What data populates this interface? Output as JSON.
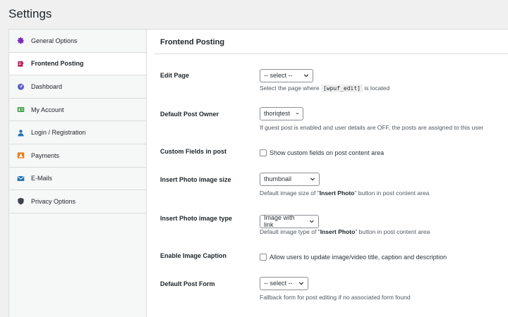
{
  "page_title": "Settings",
  "sidebar": {
    "items": [
      {
        "label": "General Options",
        "icon": "gear-icon",
        "color": "#7b2cbf",
        "active": false
      },
      {
        "label": "Frontend Posting",
        "icon": "edit-icon",
        "color": "#c2185b",
        "active": true
      },
      {
        "label": "Dashboard",
        "icon": "dashboard-icon",
        "color": "#5b5fc7",
        "active": false
      },
      {
        "label": "My Account",
        "icon": "account-card-icon",
        "color": "#43a047",
        "active": false
      },
      {
        "label": "Login / Registration",
        "icon": "user-icon",
        "color": "#2271b1",
        "active": false
      },
      {
        "label": "Payments",
        "icon": "payments-icon",
        "color": "#e67e22",
        "active": false
      },
      {
        "label": "E-Mails",
        "icon": "mail-icon",
        "color": "#2271b1",
        "active": false
      },
      {
        "label": "Privacy Options",
        "icon": "shield-icon",
        "color": "#3c434a",
        "active": false
      }
    ]
  },
  "main": {
    "title": "Frontend Posting",
    "edit_page": {
      "label": "Edit Page",
      "select_value": "-- select --",
      "desc_before": "Select the page where",
      "desc_code": "[wpuf_edit]",
      "desc_after": "is located"
    },
    "default_post_owner": {
      "label": "Default Post Owner",
      "select_value": "thoriqtest",
      "desc": "If guest post is enabled and user details are OFF, the posts are assigned to this user"
    },
    "custom_fields": {
      "label": "Custom Fields in post",
      "checkbox_label": "Show custom fields on post content area",
      "checked": false
    },
    "photo_size": {
      "label": "Insert Photo image size",
      "select_value": "thumbnail",
      "desc_before": "Default image size of \"",
      "desc_bold": "Insert Photo",
      "desc_after": "\" button in post content area"
    },
    "photo_type": {
      "label": "Insert Photo image type",
      "select_value": "Image with link",
      "desc_before": "Default image type of \"",
      "desc_bold": "Insert Photo",
      "desc_after": "\" button in post content area"
    },
    "image_caption": {
      "label": "Enable Image Caption",
      "checkbox_label": "Allow users to update image/video title, caption and description",
      "checked": false
    },
    "default_post_form": {
      "label": "Default Post Form",
      "select_value": "-- select --",
      "desc": "Fallback form for post editing if no associated form found"
    }
  }
}
